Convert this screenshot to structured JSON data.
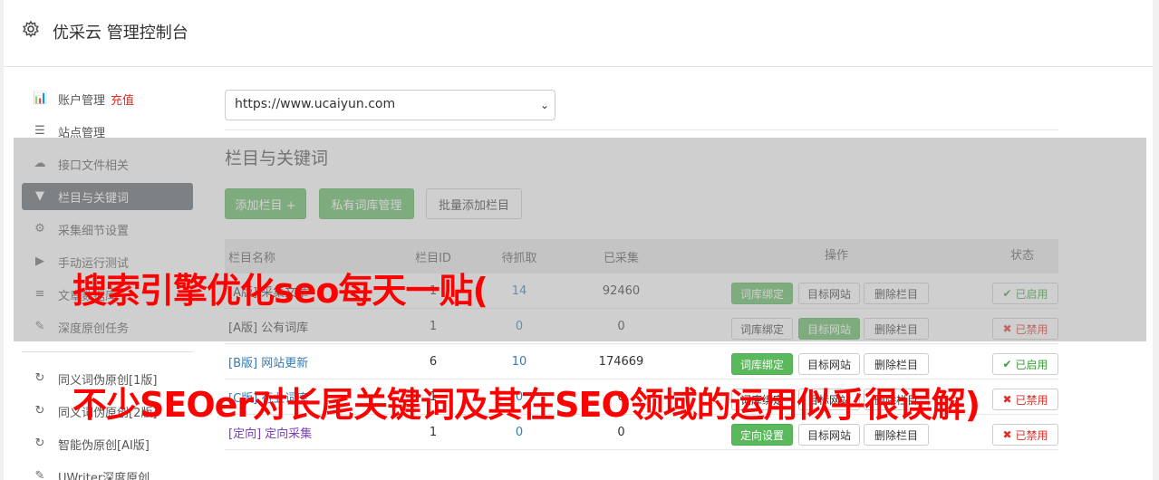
{
  "header": {
    "title": "优采云 管理控制台",
    "icon": "gear-icon"
  },
  "sidebar": {
    "items": [
      {
        "label": "账户管理",
        "extra": "充值",
        "icon": "bar-chart-icon"
      },
      {
        "label": "站点管理",
        "icon": "server-icon"
      },
      {
        "label": "接口文件相关",
        "icon": "cloud-upload-icon"
      },
      {
        "label": "栏目与关键词",
        "icon": "filter-icon",
        "active": true
      },
      {
        "label": "采集细节设置",
        "icon": "cogs-icon"
      },
      {
        "label": "手动运行测试",
        "icon": "play-circle-icon"
      },
      {
        "label": "文章数据库",
        "icon": "database-icon"
      },
      {
        "label": "深度原创任务",
        "icon": "edit-icon"
      }
    ],
    "items2": [
      {
        "label": "同义词伪原创[1版]",
        "icon": "refresh-icon"
      },
      {
        "label": "同义词伪原创[2版]",
        "icon": "refresh-icon"
      },
      {
        "label": "智能伪原创[AI版]",
        "icon": "refresh-icon"
      },
      {
        "label": "UWriter深度原创",
        "icon": "edit-icon"
      }
    ]
  },
  "site_select": {
    "value": "https://www.ucaiyun.com"
  },
  "section": {
    "title": "栏目与关键词"
  },
  "toolbar": {
    "add_label": "添加栏目 +",
    "private_label": "私有词库管理",
    "batch_label": "批量添加栏目"
  },
  "table": {
    "headers": [
      "栏目名称",
      "栏目ID",
      "待抓取",
      "已采集",
      "操作",
      "状态"
    ],
    "rows": [
      {
        "tag": "[A版]",
        "name": "采集文章",
        "id": "1",
        "pending": "14",
        "collected": "92460",
        "op1": "词库绑定",
        "op2": "目标网站",
        "op3": "删除栏目",
        "status": "已启用",
        "on": true
      },
      {
        "tag": "[A版]",
        "name": "公有词库",
        "id": "1",
        "pending": "0",
        "collected": "0",
        "op1": "词库绑定",
        "op2": "目标网站",
        "op3": "删除栏目",
        "status": "已禁用",
        "on": false
      },
      {
        "tag": "[B版]",
        "name": "网站更新",
        "id": "6",
        "pending": "10",
        "collected": "174669",
        "op1": "词库绑定",
        "op2": "目标网站",
        "op3": "删除栏目",
        "status": "已启用",
        "on": true
      },
      {
        "tag": "[C版]",
        "name": "行业词库",
        "id": "1",
        "pending": "0",
        "collected": "0",
        "op1": "词库绑定",
        "op2": "目标网站",
        "op3": "删除栏目",
        "status": "已禁用",
        "on": false
      },
      {
        "tag": "[定向]",
        "name": "定向采集",
        "id": "1",
        "pending": "0",
        "collected": "0",
        "op1": "定向设置",
        "op2": "目标网站",
        "op3": "删除栏目",
        "status": "已禁用",
        "on": false
      }
    ]
  },
  "watermark": {
    "line1": "搜索引擎优化seo每天一贴(",
    "line2": "不少SEOer对长尾关键词及其在SEO领域的运用似乎很误解)"
  }
}
